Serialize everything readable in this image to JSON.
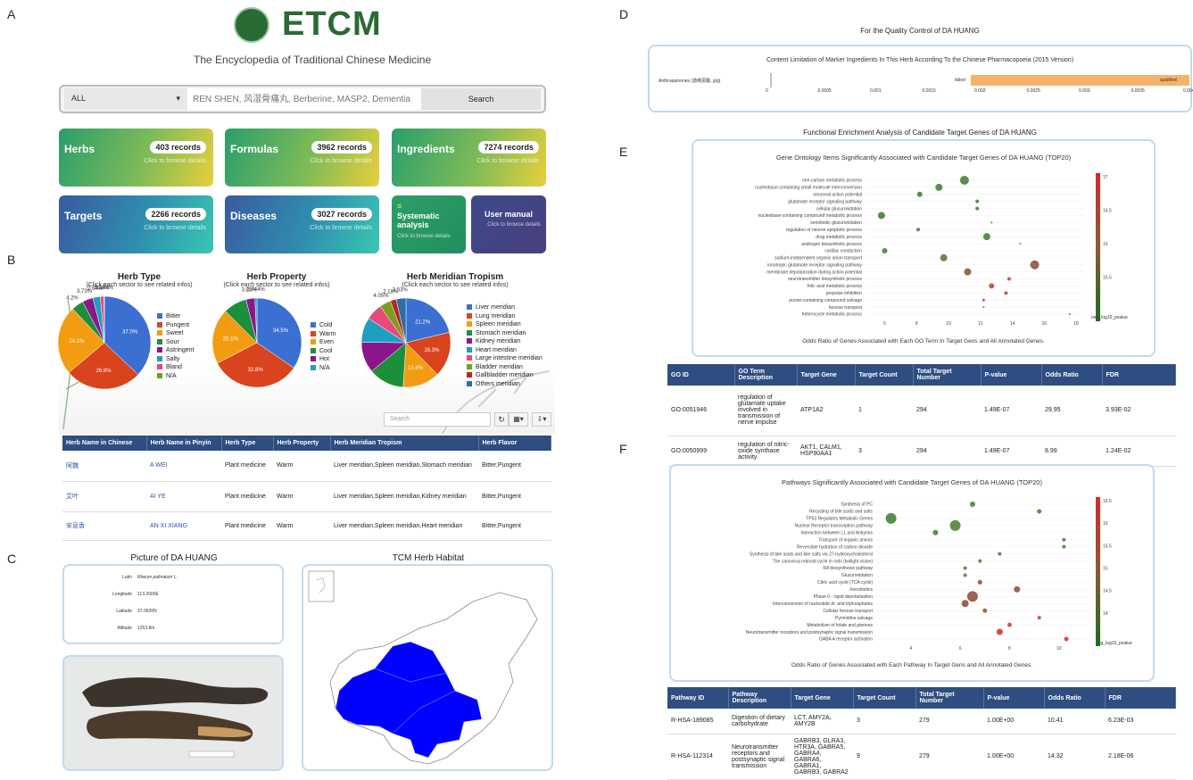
{
  "panel_labels": {
    "a": "A",
    "b": "B",
    "c": "C",
    "d": "D",
    "e": "E",
    "f": "F"
  },
  "header": {
    "logo_text": "ETCM",
    "subtitle": "The Encyclopedia of Traditional Chinese Medicine"
  },
  "search": {
    "select_value": "ALL",
    "placeholder": "REN SHEN, 风湿骨痛丸, Berberine, MASP2, Dementia",
    "button": "Search"
  },
  "cards": [
    {
      "title": "Herbs",
      "count": "403 records",
      "sub": "Click to browse details"
    },
    {
      "title": "Formulas",
      "count": "3962 records",
      "sub": "Click to browse details"
    },
    {
      "title": "Ingredients",
      "count": "7274 records",
      "sub": "Click to browse details"
    },
    {
      "title": "Targets",
      "count": "2266 records",
      "sub": "Click to browse details"
    },
    {
      "title": "Diseases",
      "count": "3027 records",
      "sub": "Click to browse details"
    },
    {
      "title": "Systematic analysis",
      "count": "",
      "sub": "Click to browse details"
    },
    {
      "title": "User manual",
      "count": "",
      "sub": "Click to browse details"
    }
  ],
  "chart_data": [
    {
      "type": "pie",
      "title": "Herb Type",
      "subtitle": "(Click each sector to see related infos)",
      "categories": [
        "Bitter",
        "Pungent",
        "Sweet",
        "Sour",
        "Astringent",
        "Salty",
        "Bland",
        "N/A"
      ],
      "values": [
        37.0,
        26.8,
        24.1,
        4.2,
        3.73,
        2.64,
        1.24,
        0.156
      ],
      "labels": [
        "37.0%",
        "26.8%",
        "24.1%",
        "4.2%",
        "3.73%",
        "2.64%",
        "1.24%",
        "0.156%"
      ],
      "colors": [
        "#3b6fd1",
        "#d9431d",
        "#f39c12",
        "#1d8f3a",
        "#8b168c",
        "#1f9fc0",
        "#e8487a",
        "#7a9e1f"
      ]
    },
    {
      "type": "pie",
      "title": "Herb Property",
      "subtitle": "(Click each sector to see related infos)",
      "categories": [
        "Cold",
        "Warm",
        "Even",
        "Cool",
        "Hot",
        "N/A"
      ],
      "values": [
        34.5,
        32.8,
        20.1,
        8.5,
        3.23,
        0.744
      ],
      "labels": [
        "34.5%",
        "32.8%",
        "20.1%",
        "",
        "3.23%",
        "0.744%"
      ],
      "colors": [
        "#3b6fd1",
        "#d9431d",
        "#f39c12",
        "#1d8f3a",
        "#8b168c",
        "#1f9fc0"
      ]
    },
    {
      "type": "pie",
      "title": "Herb Meridian Tropism",
      "subtitle": "(Click each sector to see related infos)",
      "categories": [
        "Liver meridian",
        "Lung meridian",
        "Spleen meridian",
        "Stomach meridian",
        "Kidney meridian",
        "Heart meridian",
        "Large intestine meridian",
        "Bladder meridian",
        "Gallbladder meridian",
        "Others meridian"
      ],
      "values": [
        21.2,
        16.3,
        13.4,
        12.9,
        11.2,
        9.0,
        6.0,
        4.05,
        2.18,
        3.53
      ],
      "labels": [
        "21.2%",
        "16.3%",
        "13.4%",
        "",
        "",
        "",
        "",
        "4.05%",
        "2.18%",
        "3.53%"
      ],
      "colors": [
        "#3b6fd1",
        "#d9431d",
        "#f39c12",
        "#1d8f3a",
        "#8b168c",
        "#1f9fc0",
        "#e8487a",
        "#7a9e1f",
        "#b5281f",
        "#2e6da4"
      ]
    }
  ],
  "herb_table": {
    "search_placeholder": "Search",
    "headers": [
      "Herb Name in Chinese",
      "Herb Name in Pinyin",
      "Herb Type",
      "Herb Property",
      "Herb Meridian Tropism",
      "Herb Flavor"
    ],
    "rows": [
      [
        "阿魏",
        "A WEI",
        "Plant medicine",
        "Warm",
        "Liver meridian,Spleen meridian,Stomach meridian",
        "Bitter,Pungent"
      ],
      [
        "艾叶",
        "AI YE",
        "Plant medicine",
        "Warm",
        "Liver meridian,Spleen meridian,Kidney meridian",
        "Bitter,Pungent"
      ],
      [
        "安息香",
        "AN XI XIANG",
        "Plant medicine",
        "Warm",
        "Liver meridian,Spleen meridian,Heart meridian",
        "Bitter,Pungent"
      ]
    ]
  },
  "picture": {
    "title": "Picture of DA HUANG",
    "fields": [
      {
        "k": "Latin",
        "v": "Rheum palmatum L."
      },
      {
        "k": "Longitude",
        "v": "113.2000E"
      },
      {
        "k": "Latitude",
        "v": "37.0920N"
      },
      {
        "k": "Altitude",
        "v": "1253.8m"
      }
    ]
  },
  "habitat": {
    "title": "TCM Herb Habitat"
  },
  "quality": {
    "title": "For the Quality Control of DA HUANG",
    "inner_title": "Content Limitation of Marker Ingredients In This Herb According To the Chinese Pharmacopoeia (2015 Version)",
    "row_label": "Anthraquinones (游离蒽醌, g/g)",
    "failed": "failed",
    "qualified": "qualified",
    "ticks": [
      "0",
      "0.0005",
      "0.001",
      "0.0015",
      "0.002",
      "0.0025",
      "0.003",
      "0.0035",
      "0.004"
    ]
  },
  "enrichment": {
    "title": "Functional Enrichment Analysis of Candidate Target Genes of DA HUANG"
  },
  "go_chart": {
    "title": "Gene Ontology Items Significantly Associated with Candidate Target Genes of DA HUANG (TOP20)",
    "xlabel": "Odds Ratio of Genes Associated with Each GO Term In Target Gens and All Annotated Genes.",
    "colorbar_label": "neg_log10_pvalue",
    "colorbar_ticks": [
      "17",
      "16.5",
      "16",
      "15.5"
    ],
    "x_ticks": [
      "6",
      "8",
      "10",
      "12",
      "14",
      "16",
      "18"
    ],
    "terms": [
      "one-carbon metabolic process",
      "nucleobase-containing small molecule interconversion",
      "neuronal action potential",
      "glutamate receptor signaling pathway",
      "cellular glucuronidation",
      "nucleobase-containing compound metabolic process",
      "xenobiotic glucuronidation",
      "regulation of neuron apoptotic process",
      "drug metabolic process",
      "androgen biosynthetic process",
      "cardiac conduction",
      "sodium-independent organic anion transport",
      "ionotropic glutamate receptor signaling pathway",
      "membrane depolarization during action potential",
      "neurotransmitter biosynthetic process",
      "folic acid metabolic process",
      "prepulse inhibition",
      "purine-containing compound salvage",
      "hexose transport",
      "heterocycle metabolic process"
    ],
    "x": [
      11.0,
      9.4,
      8.2,
      11.8,
      11.8,
      5.8,
      12.7,
      8.1,
      12.4,
      14.5,
      6.0,
      9.7,
      15.4,
      11.2,
      13.8,
      12.7,
      13.6,
      12.2,
      12.2,
      17.6
    ],
    "size": [
      5,
      4,
      3,
      2,
      2,
      4,
      1,
      2,
      4,
      1,
      3,
      4,
      5,
      4,
      2,
      3,
      2,
      1.5,
      1,
      1
    ],
    "color": [
      "#3a7d2c",
      "#3a7d2c",
      "#3a7d2c",
      "#3a7d2c",
      "#3a7d2c",
      "#3a7d2c",
      "#3a7d2c",
      "#3a7d2c",
      "#3a7d2c",
      "#7d6a3a",
      "#3a7d2c",
      "#6a6a30",
      "#8a4a30",
      "#8a4a30",
      "#b04a30",
      "#a04a30",
      "#c33c30",
      "#c33c30",
      "#c33c30",
      "#d42a2a"
    ]
  },
  "go_table": {
    "headers": [
      "GO ID",
      "GO Term Description",
      "Target Gene",
      "Target Count",
      "Total Target Number",
      "P-value",
      "Odds Ratio",
      "FDR"
    ],
    "rows": [
      [
        "GO:0051946",
        "regulation of glutamate uptake involved in transmission of nerve impulse",
        "ATP1A2",
        "1",
        "294",
        "1.49E-07",
        "29.95",
        "3.93E-02"
      ],
      [
        "GO:0050999",
        "regulation of nitric-oxide synthase activity",
        "AKT1, CALM1, HSP90AA1",
        "3",
        "294",
        "1.49E-07",
        "8.99",
        "1.24E-02"
      ]
    ]
  },
  "pathway_chart": {
    "title": "Pathways Significantly Associated with Candidate Target Genes of DA HUANG (TOP20)",
    "xlabel": "Odds Ratio of Genes Associated with Each Pathway In Target Gens and All Annotated Genes.",
    "colorbar_label": "neg_log10_pvalue",
    "colorbar_ticks": [
      "16.5",
      "16",
      "15.5",
      "15",
      "14.5",
      "14"
    ],
    "x_ticks": [
      "4",
      "6",
      "8",
      "10"
    ],
    "terms": [
      "Synthesis of PC",
      "Recycling of bile acids and salts",
      "TP53 Regulates Metabolic Genes",
      "Nuclear Receptor transcription pathway",
      "Interaction between L1 and Ankyrins",
      "Transport of organic anions",
      "Reversible hydration of carbon dioxide",
      "Synthesis of bile acids and bile salts via 27-hydroxycholesterol",
      "The canonical retinoid cycle in rods (twilight vision)",
      "RA biosynthesis pathway",
      "Glucuronidation",
      "Citric acid cycle (TCA cycle)",
      "Xenobiotics",
      "Phase 0 - rapid depolarisation",
      "Interconversion of nucleotide di- and triphosphates",
      "Cellular hexose transport",
      "Pyrimidine salvage",
      "Metabolism of folate and pterines",
      "Neurotransmitter receptors and postsynaptic signal transmission",
      "GABA A receptor activation"
    ],
    "x": [
      6.5,
      9.2,
      3.2,
      5.8,
      5.0,
      10.2,
      10.2,
      7.6,
      6.8,
      6.2,
      6.2,
      6.8,
      8.3,
      6.5,
      6.2,
      7.0,
      9.2,
      8.0,
      7.6,
      10.3
    ],
    "size": [
      3,
      2.5,
      6,
      6,
      3,
      2,
      2,
      2,
      2,
      2,
      2,
      2.5,
      3.5,
      6,
      4,
      2.5,
      2,
      2.5,
      3.5,
      2.5
    ],
    "color": [
      "#3a7d2c",
      "#3a7d2c",
      "#3a7d2c",
      "#4a7a30",
      "#3a7d2c",
      "#3a7d2c",
      "#3a7d2c",
      "#3a7d2c",
      "#3a7d2c",
      "#6a6a30",
      "#6a6a30",
      "#8a4a30",
      "#8a4a30",
      "#8a4a30",
      "#8a4a30",
      "#a04a30",
      "#c33c30",
      "#c33c30",
      "#d42a2a",
      "#d42a2a"
    ]
  },
  "pathway_table": {
    "headers": [
      "Pathway ID",
      "Pathway Description",
      "Target Gene",
      "Target Count",
      "Total Target Number",
      "P-value",
      "Odds Ratio",
      "FDR"
    ],
    "rows": [
      [
        "R-HSA-189085",
        "Digestion of dietary carbohydrate",
        "LCT, AMY2A, AMY2B",
        "3",
        "279",
        "1.00E+00",
        "10.41",
        "6.23E-03"
      ],
      [
        "R-HSA-112314",
        "Neurotransmitter receptors and postsynaptic signal transmission",
        "GABRB3, GLRA3, HTR3A, GABRA5, GABRA4, GABRA6, GABRA1, GABRB3, GABRA2",
        "9",
        "279",
        "1.00E+00",
        "14.32",
        "2.18E-06"
      ]
    ]
  }
}
